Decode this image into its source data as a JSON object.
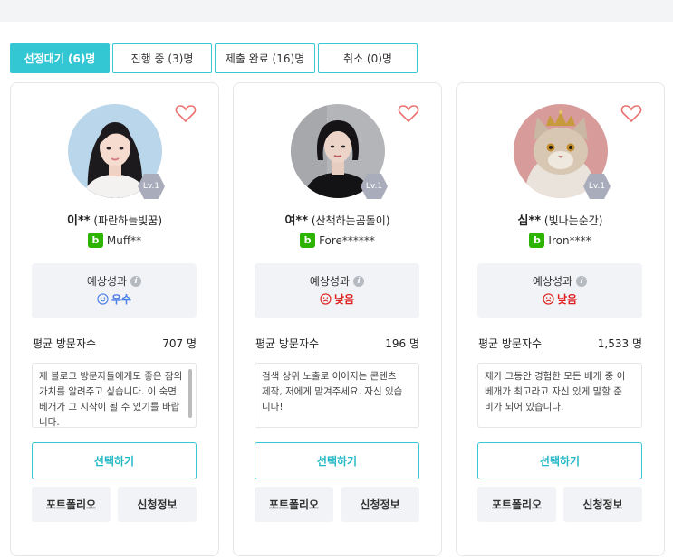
{
  "tabs": [
    {
      "label": "선정대기 (6)명",
      "active": true
    },
    {
      "label": "진행 중 (3)명",
      "active": false
    },
    {
      "label": "제출 완료 (16)명",
      "active": false
    },
    {
      "label": "취소 (0)명",
      "active": false
    }
  ],
  "labels": {
    "performance": "예상성과",
    "visitors": "평균 방문자수",
    "select": "선택하기",
    "portfolio": "포트폴리오",
    "application_info": "신청정보"
  },
  "cards": [
    {
      "name": "이**",
      "nickname": "(파란하늘빛꿈)",
      "level": "Lv.1",
      "blog_id": "Muff**",
      "performance": "우수",
      "performance_color": "#4a7ee8",
      "visitors": "707 명",
      "description": "제 블로그 방문자들에게도 좋은 잠의 가치를 알려주고 싶습니다. 이 숙면 베개가 그 시작이 될 수 있기를 바랍니다.",
      "avatar_icon": "woman-photo"
    },
    {
      "name": "여**",
      "nickname": "(산책하는곰돌이)",
      "level": "Lv.1",
      "blog_id": "Fore******",
      "performance": "낮음",
      "performance_color": "#e02020",
      "visitors": "196 명",
      "description": "검색 상위 노출로 이어지는 콘텐츠 제작, 저에게 맡겨주세요. 자신 있습니다!",
      "avatar_icon": "woman-photo"
    },
    {
      "name": "심**",
      "nickname": "(빛나는순간)",
      "level": "Lv.1",
      "blog_id": "Iron****",
      "performance": "낮음",
      "performance_color": "#e02020",
      "visitors": "1,533 명",
      "description": "제가 그동안 경험한 모든 베개 중 이 베개가 최고라고 자신 있게 말할 준비가 되어 있습니다.",
      "avatar_icon": "cat-crown-photo"
    }
  ]
}
